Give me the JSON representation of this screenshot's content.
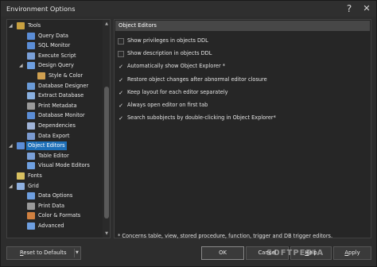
{
  "window": {
    "title": "Environment Options",
    "help_glyph": "?",
    "close_glyph": "✕"
  },
  "tree": {
    "items": [
      {
        "label": "Tools",
        "icon": "tools-icon"
      },
      {
        "label": "Query Data",
        "icon": "query-data-icon"
      },
      {
        "label": "SQL Monitor",
        "icon": "sql-monitor-icon"
      },
      {
        "label": "Execute Script",
        "icon": "execute-script-icon"
      },
      {
        "label": "Design Query",
        "icon": "design-query-icon"
      },
      {
        "label": "Style & Color",
        "icon": "style-color-icon"
      },
      {
        "label": "Database Designer",
        "icon": "database-designer-icon"
      },
      {
        "label": "Extract Database",
        "icon": "extract-database-icon"
      },
      {
        "label": "Print Metadata",
        "icon": "print-metadata-icon"
      },
      {
        "label": "Database Monitor",
        "icon": "database-monitor-icon"
      },
      {
        "label": "Dependencies",
        "icon": "dependencies-icon"
      },
      {
        "label": "Data Export",
        "icon": "data-export-icon"
      },
      {
        "label": "Object Editors",
        "icon": "object-editors-icon"
      },
      {
        "label": "Table Editor",
        "icon": "table-editor-icon"
      },
      {
        "label": "Visual Mode Editors",
        "icon": "visual-mode-editors-icon"
      },
      {
        "label": "Fonts",
        "icon": "fonts-icon"
      },
      {
        "label": "Grid",
        "icon": "grid-icon"
      },
      {
        "label": "Data Options",
        "icon": "data-options-icon"
      },
      {
        "label": "Print Data",
        "icon": "print-data-icon"
      },
      {
        "label": "Color & Formats",
        "icon": "color-formats-icon"
      },
      {
        "label": "Advanced",
        "icon": "advanced-icon"
      }
    ],
    "selected": "Object Editors"
  },
  "panel": {
    "header": "Object Editors",
    "options": [
      {
        "label": "Show privileges in objects DDL",
        "checked": false
      },
      {
        "label": "Show description in objects DDL",
        "checked": false
      },
      {
        "label": "Automatically show Object Explorer *",
        "checked": true
      },
      {
        "label": "Restore object changes after abnormal editor closure",
        "checked": true
      },
      {
        "label": "Keep layout for each editor separately",
        "checked": true
      },
      {
        "label": "Always open editor on first tab",
        "checked": true
      },
      {
        "label": "Search subobjects by double-clicking in Object Explorer*",
        "checked": true
      }
    ],
    "note": "* Concerns table, view, stored procedure, function, trigger and DB trigger editors."
  },
  "buttons": {
    "reset_u": "R",
    "reset_rest": "eset to Defaults",
    "ok": "OK",
    "cancel": "Cancel",
    "help_u": "H",
    "help_rest": "elp",
    "apply_u": "A",
    "apply_rest": "pply"
  },
  "watermark": "SOFTPEDIA"
}
